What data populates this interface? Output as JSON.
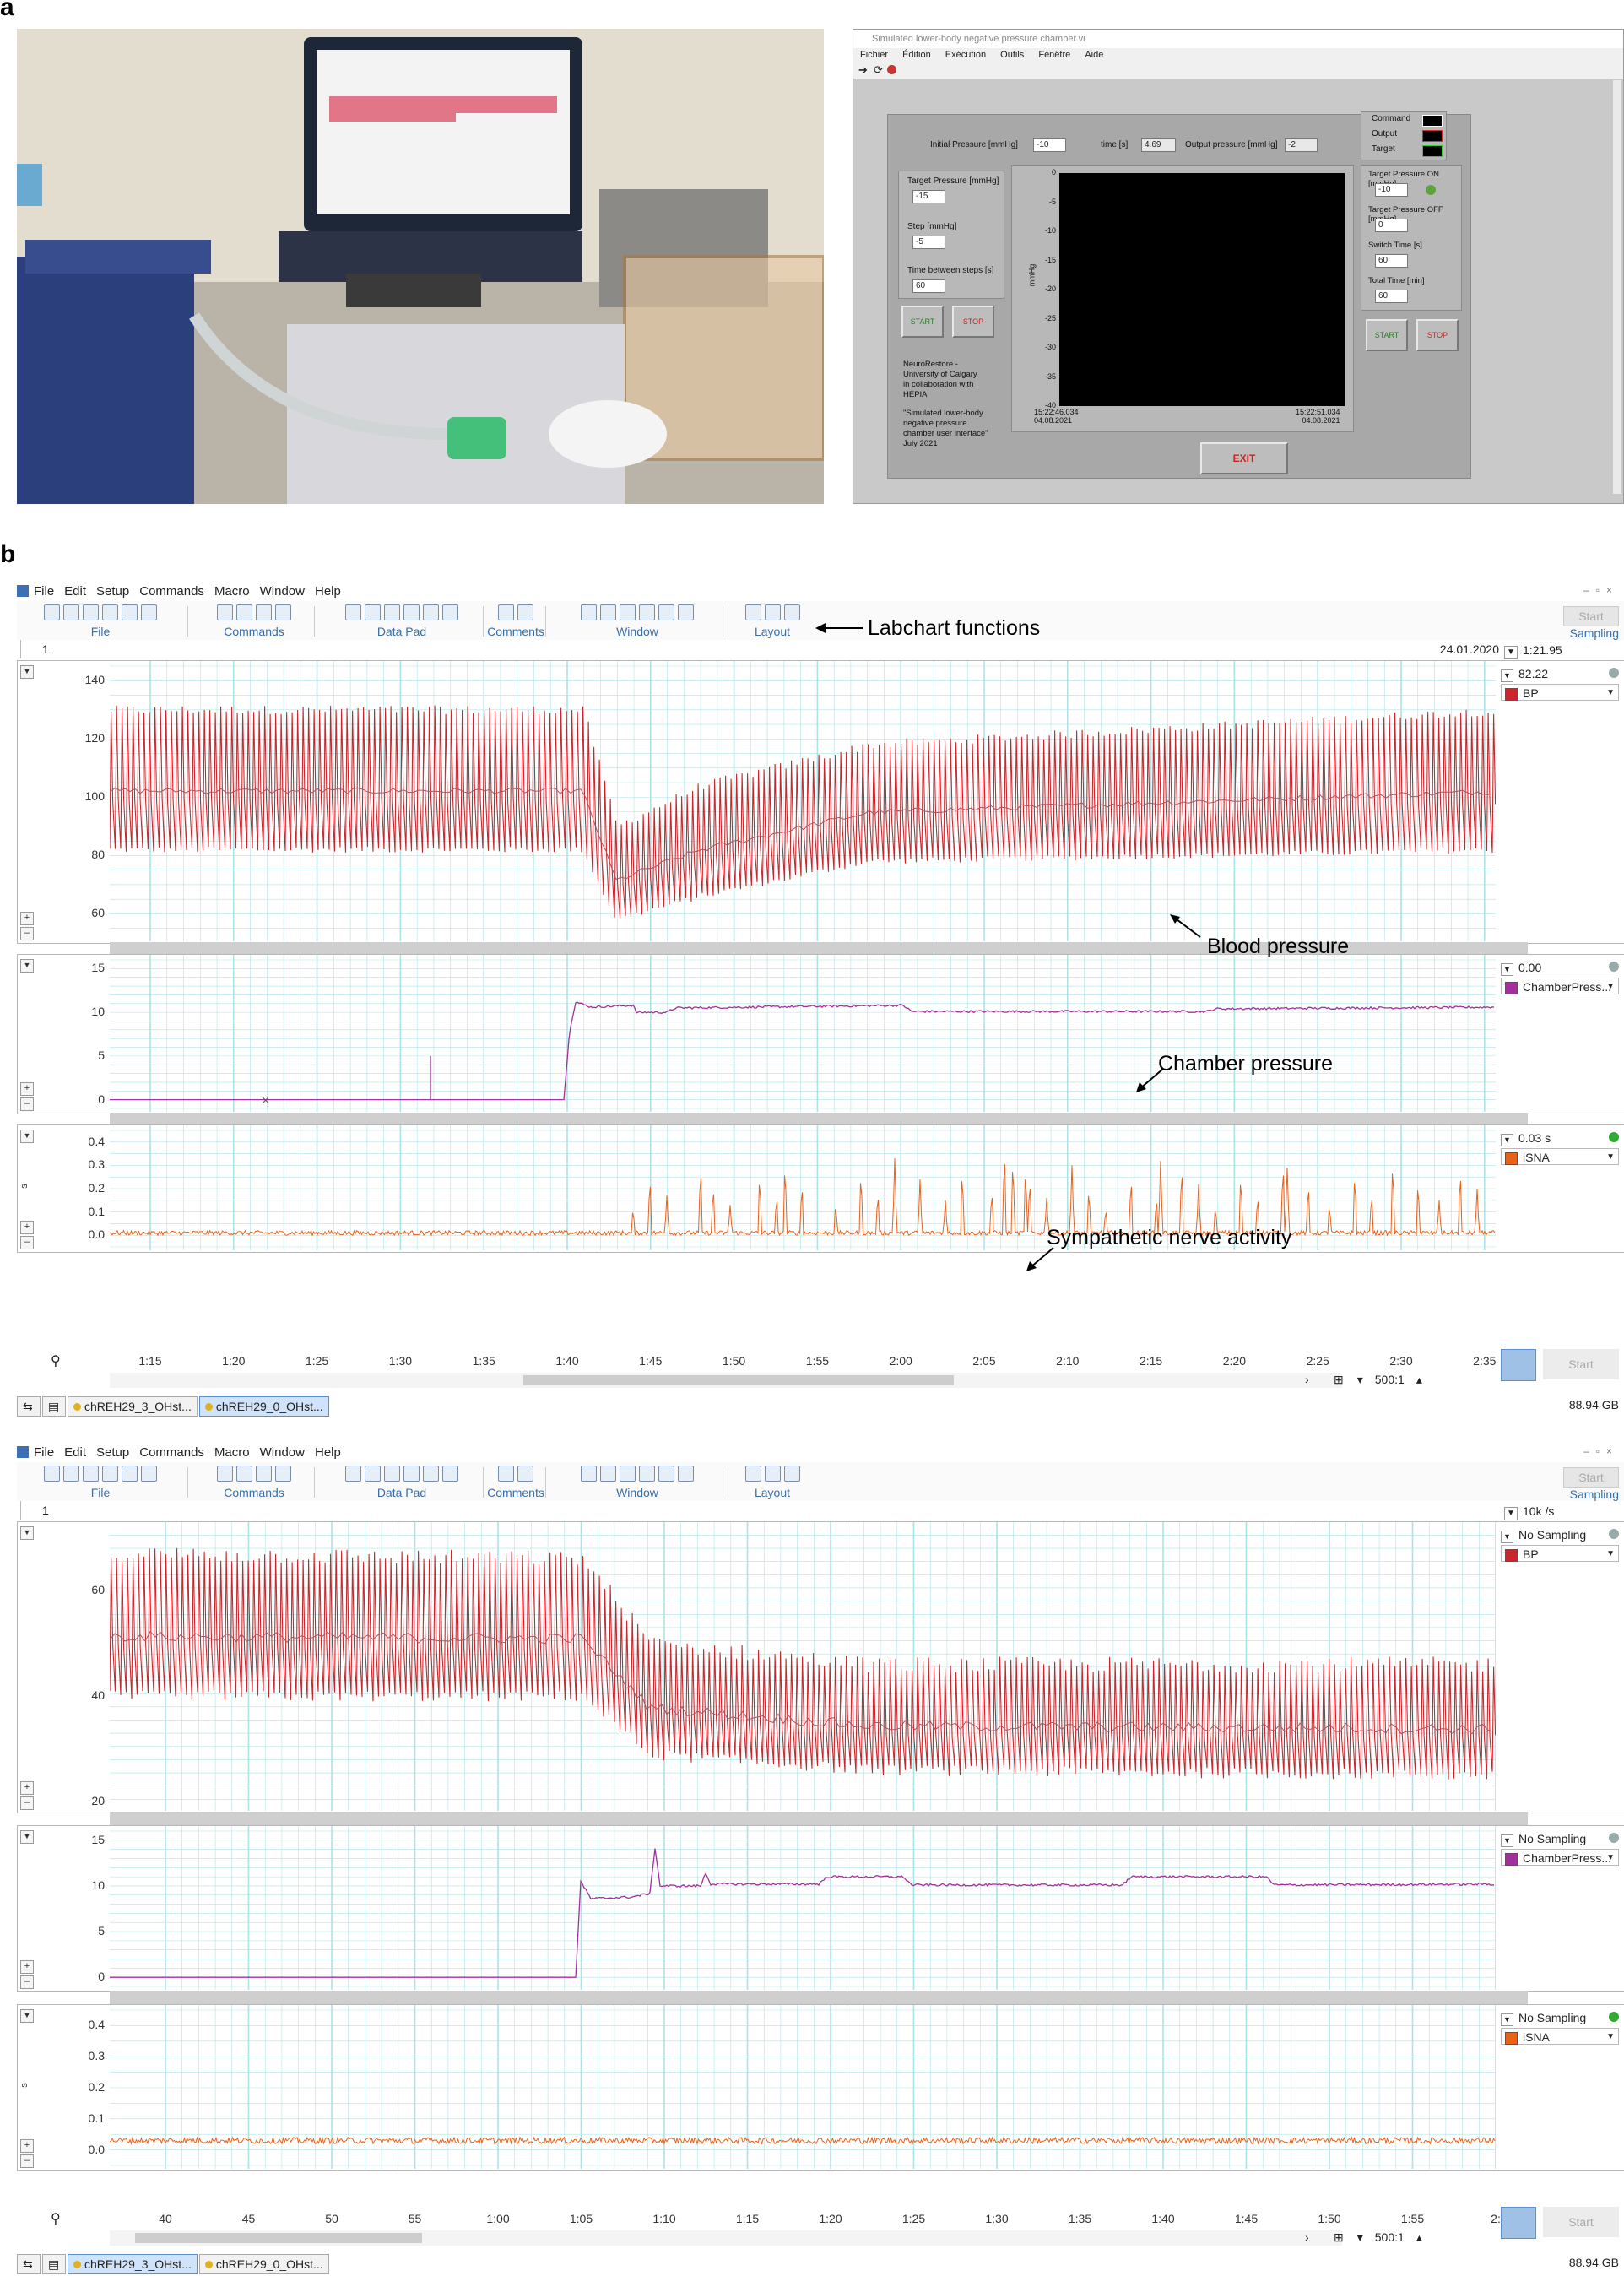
{
  "panel_a": {
    "letter": "a",
    "labview": {
      "title": "Simulated lower-body negative pressure chamber.vi",
      "menu": [
        "Fichier",
        "Édition",
        "Exécution",
        "Outils",
        "Fenêtre",
        "Aide"
      ],
      "initial_pressure_label": "Initial Pressure [mmHg]",
      "initial_pressure_value": "-10",
      "time_label": "time [s]",
      "time_value": "4.69",
      "output_pressure_label": "Output pressure [mmHg]",
      "output_pressure_value": "-2",
      "legend": [
        "Command",
        "Output",
        "Target"
      ],
      "target_pressure_label": "Target Pressure [mmHg]",
      "target_pressure_value": "-15",
      "step_label": "Step [mmHg]",
      "step_value": "-5",
      "time_between_steps_label": "Time between steps [s]",
      "time_between_steps_value": "60",
      "start_label": "START",
      "stop_label": "STOP",
      "credits": [
        "NeuroRestore -",
        "University of Calgary",
        "in collaboration with",
        "HEPIA",
        "",
        "\"Simulated lower-body",
        "negative pressure",
        "chamber user interface\"",
        "July 2021"
      ],
      "ylabel": "mmHg",
      "yticks": [
        "0",
        "-5",
        "-10",
        "-15",
        "-20",
        "-25",
        "-30",
        "-35",
        "-40"
      ],
      "time_left": [
        "15:22:46.034",
        "04.08.2021"
      ],
      "time_right": [
        "15:22:51.034",
        "04.08.2021"
      ],
      "target_on_label": "Target Pressure ON [mmHg]",
      "target_on_value": "-10",
      "target_off_label": "Target Pressure OFF [mmHg]",
      "target_off_value": "0",
      "switch_time_label": "Switch Time [s]",
      "switch_time_value": "60",
      "total_time_label": "Total Time [min]",
      "total_time_value": "60",
      "exit_label": "EXIT"
    }
  },
  "panel_b": {
    "letter": "b",
    "menu": [
      "File",
      "Edit",
      "Setup",
      "Commands",
      "Macro",
      "Window",
      "Help"
    ],
    "toolbar_groups": [
      "File",
      "Commands",
      "Data Pad",
      "Comments",
      "Window",
      "Layout"
    ],
    "toolbar_start": "Start",
    "toolbar_sampling": "Sampling",
    "annotation_functions": "Labchart functions",
    "annotation_bp": "Blood pressure",
    "annotation_chamber": "Chamber pressure",
    "annotation_sna": "Sympathetic nerve activity",
    "win1": {
      "row_index": "1",
      "date": "24.01.2020",
      "time_readout": "1:21.95",
      "bp_value": "82.22",
      "bp_channel": "BP",
      "chamber_value": "0.00",
      "chamber_channel": "ChamberPress...",
      "sna_value": "0.03 s",
      "sna_channel": "iSNA",
      "bp_yticks": [
        "140",
        "120",
        "100",
        "80",
        "60"
      ],
      "ch_yticks": [
        "15",
        "10",
        "5",
        "0"
      ],
      "sna_yticks": [
        "0.4",
        "0.3",
        "0.2",
        "0.1",
        "0.0"
      ],
      "sna_unit": "s",
      "xticks": [
        "1:15",
        "1:20",
        "1:25",
        "1:30",
        "1:35",
        "1:40",
        "1:45",
        "1:50",
        "1:55",
        "2:00",
        "2:05",
        "2:10",
        "2:15",
        "2:20",
        "2:25",
        "2:30",
        "2:35"
      ],
      "zoom": "500:1",
      "tabs": [
        "chREH29_3_OHst...",
        "chREH29_0_OHst..."
      ],
      "disk": "88.94 GB",
      "start": "Start"
    },
    "win2": {
      "row_index": "1",
      "rate": "10k /s",
      "bp_value": "No Sampling",
      "bp_channel": "BP",
      "chamber_value": "No Sampling",
      "chamber_channel": "ChamberPress...",
      "sna_value": "No Sampling",
      "sna_channel": "iSNA",
      "bp_yticks": [
        "60",
        "40",
        "20"
      ],
      "ch_yticks": [
        "15",
        "10",
        "5",
        "0"
      ],
      "sna_yticks": [
        "0.4",
        "0.3",
        "0.2",
        "0.1",
        "0.0"
      ],
      "sna_unit": "s",
      "xticks": [
        "40",
        "45",
        "50",
        "55",
        "1:00",
        "1:05",
        "1:10",
        "1:15",
        "1:20",
        "1:25",
        "1:30",
        "1:35",
        "1:40",
        "1:45",
        "1:50",
        "1:55",
        "2:"
      ],
      "zoom": "500:1",
      "tabs": [
        "chREH29_3_OHst...",
        "chREH29_0_OHst..."
      ],
      "disk": "88.94 GB",
      "start": "Start"
    },
    "colors": {
      "bp": "#c8282d",
      "chamber": "#a2309a",
      "sna": "#e8621a",
      "grid": "#aee3e6"
    }
  }
}
